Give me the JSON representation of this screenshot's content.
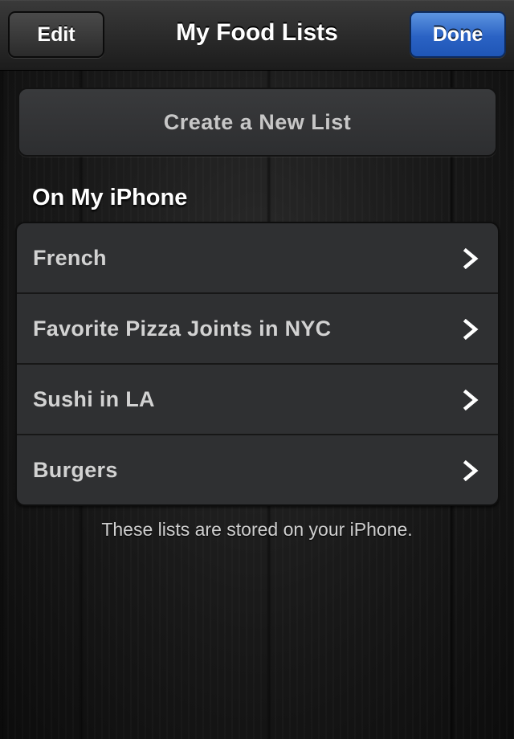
{
  "navbar": {
    "title": "My Food Lists",
    "edit_label": "Edit",
    "done_label": "Done"
  },
  "create_button": {
    "label": "Create a New List"
  },
  "section": {
    "title": "On My iPhone"
  },
  "lists": [
    {
      "label": "French",
      "icon": "chevron-right-icon"
    },
    {
      "label": "Favorite Pizza Joints in NYC",
      "icon": "chevron-right-icon"
    },
    {
      "label": "Sushi in LA",
      "icon": "chevron-right-icon"
    },
    {
      "label": "Burgers",
      "icon": "chevron-right-icon"
    }
  ],
  "footer": {
    "note": "These lists are stored on your iPhone."
  },
  "colors": {
    "done_button": "#2a62c4",
    "cell_background": "#2f3032",
    "background": "#141414"
  }
}
